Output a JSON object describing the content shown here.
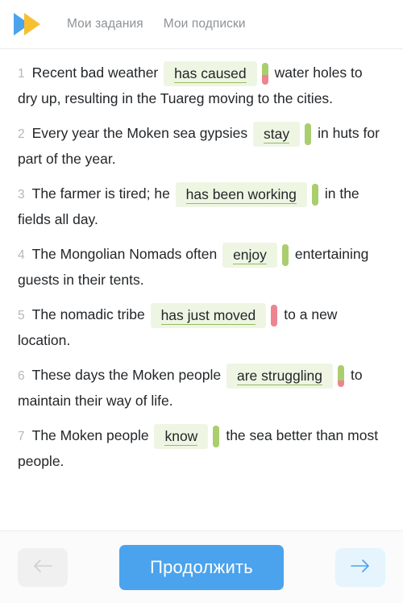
{
  "header": {
    "logo_icon": "fast-forward-logo-icon",
    "logo_colors": {
      "left": "#4ba3ed",
      "right": "#f7c033"
    },
    "nav": [
      {
        "label": "Мои задания"
      },
      {
        "label": "Мои подписки"
      }
    ]
  },
  "questions": [
    {
      "number": "1",
      "before": "Recent bad weather",
      "answer": "has caused",
      "after": "water holes to dry up, resulting in the Tuareg moving to the cities.",
      "indicator": {
        "green_pct": 55,
        "red_pct": 45
      }
    },
    {
      "number": "2",
      "before": "Every year the Moken sea gypsies",
      "answer": "stay",
      "after": "in huts for part of the year.",
      "indicator": {
        "green_pct": 100,
        "red_pct": 0
      }
    },
    {
      "number": "3",
      "before": "The farmer is tired; he",
      "answer": "has been working",
      "after": "in the fields all day.",
      "indicator": {
        "green_pct": 100,
        "red_pct": 0
      }
    },
    {
      "number": "4",
      "before": "The Mongolian Nomads often",
      "answer": "enjoy",
      "after": "entertaining guests in their tents.",
      "indicator": {
        "green_pct": 100,
        "red_pct": 0
      }
    },
    {
      "number": "5",
      "before": "The nomadic tribe",
      "answer": "has just moved",
      "after": "to a new location.",
      "indicator": {
        "green_pct": 0,
        "red_pct": 100
      }
    },
    {
      "number": "6",
      "before": "These days the Moken people",
      "answer": "are struggling",
      "after": "to maintain their way of life.",
      "indicator": {
        "green_pct": 70,
        "red_pct": 30
      }
    },
    {
      "number": "7",
      "before": "The Moken people",
      "answer": "know",
      "after": "the sea better than most people.",
      "indicator": {
        "green_pct": 100,
        "red_pct": 0
      }
    }
  ],
  "footer": {
    "prev_icon": "arrow-left-icon",
    "next_icon": "arrow-right-icon",
    "continue_label": "Продолжить",
    "accent_color": "#4ba3ed"
  }
}
